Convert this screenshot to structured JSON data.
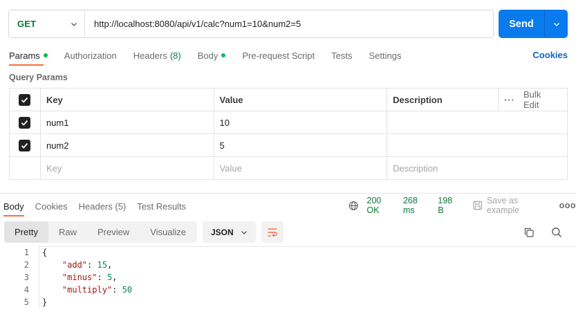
{
  "request": {
    "method": "GET",
    "url": "http://localhost:8080/api/v1/calc?num1=10&num2=5",
    "send_label": "Send"
  },
  "request_tabs": [
    {
      "label": "Params",
      "active": true,
      "dot": true
    },
    {
      "label": "Authorization"
    },
    {
      "label": "Headers",
      "count": "(8)"
    },
    {
      "label": "Body",
      "dot": true
    },
    {
      "label": "Pre-request Script"
    },
    {
      "label": "Tests"
    },
    {
      "label": "Settings"
    }
  ],
  "cookies_label": "Cookies",
  "query_params": {
    "title": "Query Params",
    "headers": {
      "key": "Key",
      "value": "Value",
      "description": "Description",
      "bulk_edit": "Bulk Edit"
    },
    "rows": [
      {
        "checked": true,
        "key": "num1",
        "value": "10",
        "description": ""
      },
      {
        "checked": true,
        "key": "num2",
        "value": "5",
        "description": ""
      }
    ],
    "placeholder": {
      "key": "Key",
      "value": "Value",
      "description": "Description"
    }
  },
  "response_tabs": [
    {
      "label": "Body",
      "active": true
    },
    {
      "label": "Cookies"
    },
    {
      "label": "Headers (5)"
    },
    {
      "label": "Test Results"
    }
  ],
  "status": {
    "code": "200 OK",
    "time": "268 ms",
    "size": "198 B",
    "save_label": "Save as example"
  },
  "view_modes": [
    {
      "label": "Pretty",
      "active": true
    },
    {
      "label": "Raw"
    },
    {
      "label": "Preview"
    },
    {
      "label": "Visualize"
    }
  ],
  "format": "JSON",
  "code_lines": [
    {
      "num": "1",
      "parts": [
        [
          "p",
          "{"
        ]
      ]
    },
    {
      "num": "2",
      "parts": [
        [
          "p",
          "    "
        ],
        [
          "k",
          "\"add\""
        ],
        [
          "p",
          ": "
        ],
        [
          "n",
          "15"
        ],
        [
          "p",
          ","
        ]
      ]
    },
    {
      "num": "3",
      "parts": [
        [
          "p",
          "    "
        ],
        [
          "k",
          "\"minus\""
        ],
        [
          "p",
          ": "
        ],
        [
          "n",
          "5"
        ],
        [
          "p",
          ","
        ]
      ]
    },
    {
      "num": "4",
      "parts": [
        [
          "p",
          "    "
        ],
        [
          "k",
          "\"multiply\""
        ],
        [
          "p",
          ": "
        ],
        [
          "n",
          "50"
        ]
      ]
    },
    {
      "num": "5",
      "parts": [
        [
          "p",
          "}"
        ]
      ]
    }
  ],
  "colors": {
    "accent": "#ff6c37",
    "send": "#097bed",
    "ok": "#0a7a3a",
    "method": "#0a7a3a"
  }
}
